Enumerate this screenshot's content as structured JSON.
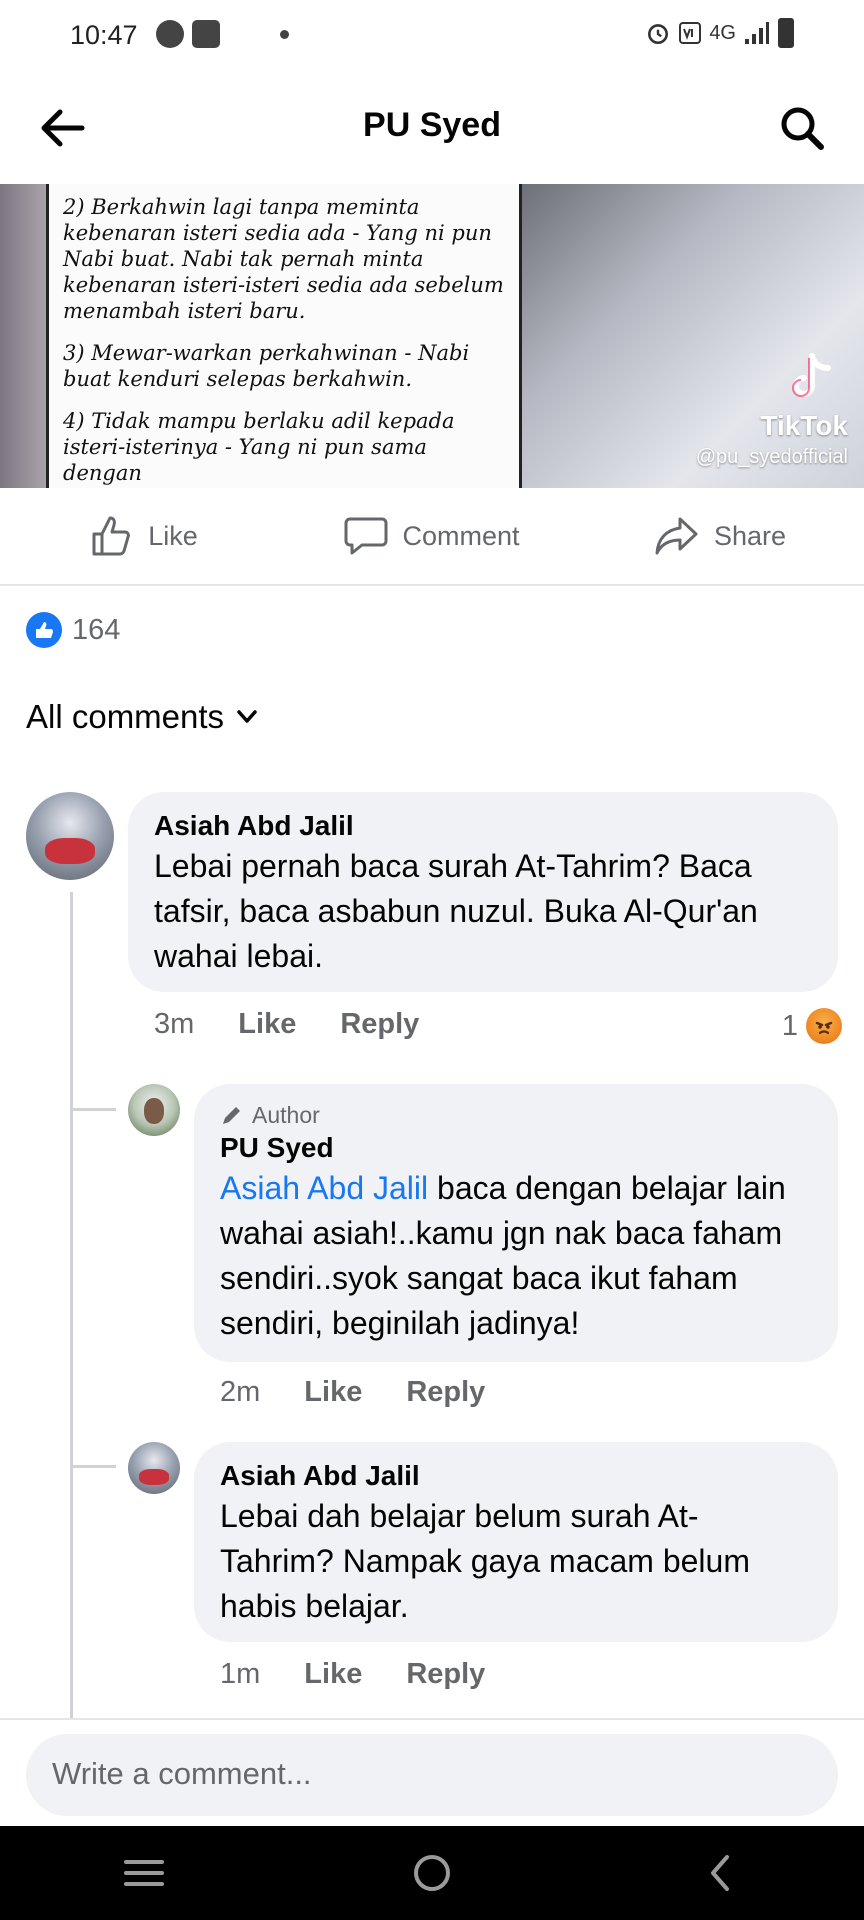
{
  "status_bar": {
    "time": "10:47",
    "network": "4G"
  },
  "header": {
    "title": "PU Syed"
  },
  "post_media": {
    "note_lines": [
      "2) Berkahwin lagi tanpa meminta kebenaran isteri sedia ada - Yang ni pun Nabi buat. Nabi tak pernah minta kebenaran isteri-isteri sedia ada sebelum menambah isteri baru.",
      "3) Mewar-warkan perkahwinan - Nabi buat kenduri selepas berkahwin.",
      "4) Tidak mampu berlaku adil kepada isteri-isterinya - Yang ni pun sama dengan"
    ],
    "watermark_brand": "TikTok",
    "watermark_handle": "@pu_syedofficial"
  },
  "actions": {
    "like": "Like",
    "comment": "Comment",
    "share": "Share"
  },
  "reactions": {
    "count": "164"
  },
  "comments_filter": {
    "label": "All comments"
  },
  "comments": [
    {
      "name": "Asiah Abd Jalil",
      "text": "Lebai pernah baca surah At-Tahrim? Baca tafsir, baca asbabun nuzul. Buka Al-Qur'an wahai lebai.",
      "time": "3m",
      "like": "Like",
      "reply": "Reply",
      "reaction_count": "1"
    },
    {
      "author_badge": "Author",
      "name": "PU Syed",
      "mention": "Asiah Abd Jalil",
      "text": " baca dengan belajar lain wahai asiah!..kamu jgn nak baca faham sendiri..syok sangat baca ikut faham sendiri, beginilah jadinya!",
      "time": "2m",
      "like": "Like",
      "reply": "Reply"
    },
    {
      "name": "Asiah Abd Jalil",
      "text": "Lebai dah belajar belum surah At-Tahrim? Nampak gaya macam belum habis belajar.",
      "time": "1m",
      "like": "Like",
      "reply": "Reply"
    }
  ],
  "composer": {
    "placeholder": "Write a comment..."
  },
  "colors": {
    "accent": "#1877f2",
    "secondary_text": "#65676b",
    "bubble": "#f0f2f5"
  }
}
